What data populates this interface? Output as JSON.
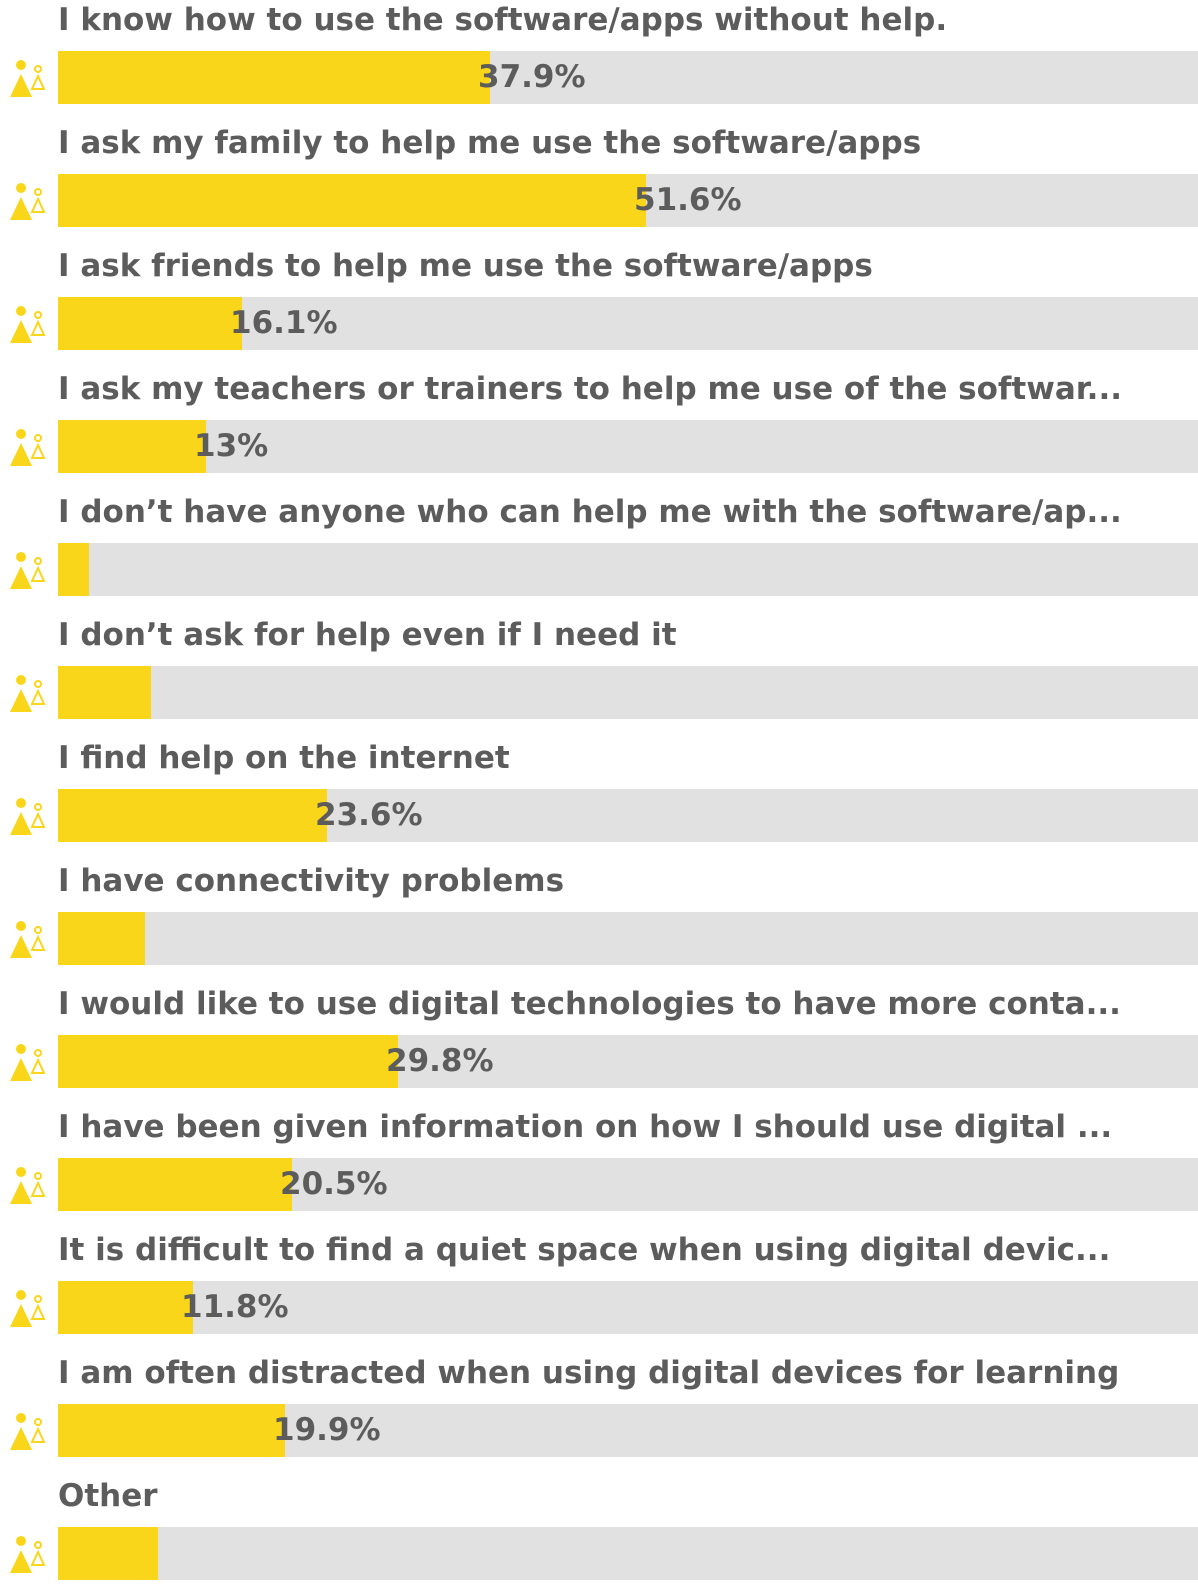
{
  "colors": {
    "bar": "#fad61a",
    "track": "#e1e1e1",
    "text": "#5c5c5c"
  },
  "icon": "people-icon",
  "chart_data": {
    "type": "bar",
    "orientation": "horizontal",
    "categories": [
      "I know how to use the software/apps without help.",
      "I ask my family to help me use the software/apps",
      "I ask friends to help me use the software/apps",
      "I ask my teachers or trainers to help me use of the softwar...",
      "I don’t have anyone who can help me with the software/ap...",
      "I don’t ask for help even if I need it",
      "I find help on the internet",
      "I have connectivity problems",
      "I would like to use digital technologies to have more conta...",
      "I have been given information on how I should use digital ...",
      "It is difficult to find a quiet space when using digital devic...",
      "I am often distracted when using digital devices for learning",
      "Other"
    ],
    "values": [
      37.9,
      51.6,
      16.1,
      13,
      2.7,
      8.2,
      23.6,
      7.6,
      29.8,
      20.5,
      11.8,
      19.9,
      8.8
    ],
    "value_labels": [
      "37.9%",
      "51.6%",
      "16.1%",
      "13%",
      "",
      "",
      "23.6%",
      "",
      "29.8%",
      "20.5%",
      "11.8%",
      "19.9%",
      ""
    ],
    "xlim": [
      0,
      100
    ],
    "legend": "none"
  }
}
